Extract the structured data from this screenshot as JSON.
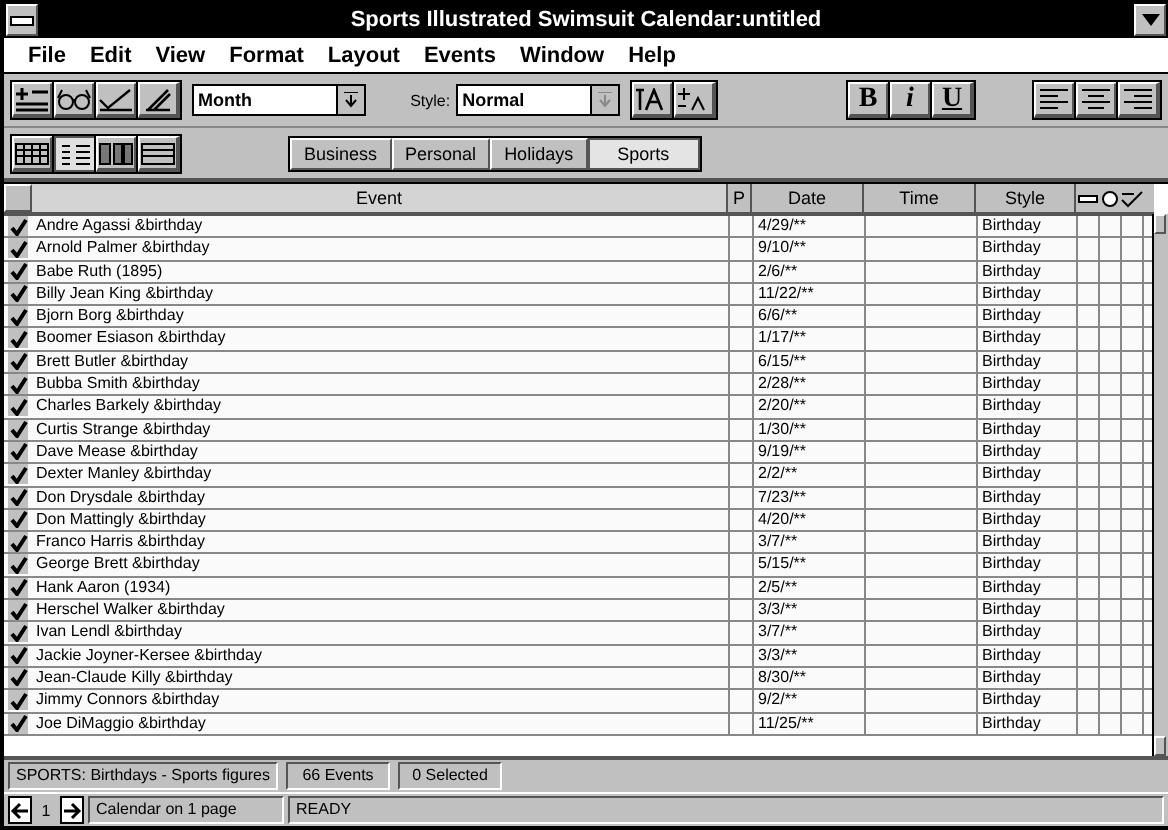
{
  "window": {
    "title": "Sports Illustrated Swimsuit Calendar:untitled"
  },
  "menu": [
    "File",
    "Edit",
    "View",
    "Format",
    "Layout",
    "Events",
    "Window",
    "Help"
  ],
  "toolbar": {
    "view_select": "Month",
    "style_label": "Style:",
    "style_select": "Normal",
    "bold": "B",
    "italic": "i",
    "underline": "U"
  },
  "categories": [
    {
      "label": "Business",
      "selected": false
    },
    {
      "label": "Personal",
      "selected": false
    },
    {
      "label": "Holidays",
      "selected": false
    },
    {
      "label": "Sports",
      "selected": true
    }
  ],
  "table": {
    "columns": [
      "Event",
      "P",
      "Date",
      "Time",
      "Style"
    ],
    "rows": [
      {
        "event": "Andre Agassi &birthday",
        "date": "4/29/**",
        "style": "Birthday",
        "checked": true
      },
      {
        "event": "Arnold Palmer &birthday",
        "date": "9/10/**",
        "style": "Birthday",
        "checked": true
      },
      {
        "event": "Babe Ruth (1895)",
        "date": "2/6/**",
        "style": "Birthday",
        "checked": true
      },
      {
        "event": "Billy Jean King &birthday",
        "date": "11/22/**",
        "style": "Birthday",
        "checked": true
      },
      {
        "event": "Bjorn Borg &birthday",
        "date": "6/6/**",
        "style": "Birthday",
        "checked": true
      },
      {
        "event": "Boomer Esiason &birthday",
        "date": "1/17/**",
        "style": "Birthday",
        "checked": true
      },
      {
        "event": "Brett Butler &birthday",
        "date": "6/15/**",
        "style": "Birthday",
        "checked": true
      },
      {
        "event": "Bubba Smith &birthday",
        "date": "2/28/**",
        "style": "Birthday",
        "checked": true
      },
      {
        "event": "Charles Barkely &birthday",
        "date": "2/20/**",
        "style": "Birthday",
        "checked": true
      },
      {
        "event": "Curtis Strange &birthday",
        "date": "1/30/**",
        "style": "Birthday",
        "checked": true
      },
      {
        "event": "Dave Mease &birthday",
        "date": "9/19/**",
        "style": "Birthday",
        "checked": true
      },
      {
        "event": "Dexter Manley &birthday",
        "date": "2/2/**",
        "style": "Birthday",
        "checked": true
      },
      {
        "event": "Don Drysdale &birthday",
        "date": "7/23/**",
        "style": "Birthday",
        "checked": true
      },
      {
        "event": "Don Mattingly &birthday",
        "date": "4/20/**",
        "style": "Birthday",
        "checked": true
      },
      {
        "event": "Franco Harris &birthday",
        "date": "3/7/**",
        "style": "Birthday",
        "checked": true
      },
      {
        "event": "George Brett &birthday",
        "date": "5/15/**",
        "style": "Birthday",
        "checked": true
      },
      {
        "event": "Hank Aaron (1934)",
        "date": "2/5/**",
        "style": "Birthday",
        "checked": true
      },
      {
        "event": "Herschel Walker &birthday",
        "date": "3/3/**",
        "style": "Birthday",
        "checked": true
      },
      {
        "event": "Ivan Lendl &birthday",
        "date": "3/7/**",
        "style": "Birthday",
        "checked": true
      },
      {
        "event": "Jackie Joyner-Kersee &birthday",
        "date": "3/3/**",
        "style": "Birthday",
        "checked": true
      },
      {
        "event": "Jean-Claude Killy &birthday",
        "date": "8/30/**",
        "style": "Birthday",
        "checked": true
      },
      {
        "event": "Jimmy Connors &birthday",
        "date": "9/2/**",
        "style": "Birthday",
        "checked": true
      },
      {
        "event": "Joe DiMaggio &birthday",
        "date": "11/25/**",
        "style": "Birthday",
        "checked": true
      }
    ]
  },
  "status_bar": [
    "SPORTS: Birthdays - Sports figures",
    "66 Events",
    "0 Selected"
  ],
  "bottom_bar": {
    "page": "1",
    "pages_label": "Calendar on 1 page",
    "state": "READY"
  }
}
